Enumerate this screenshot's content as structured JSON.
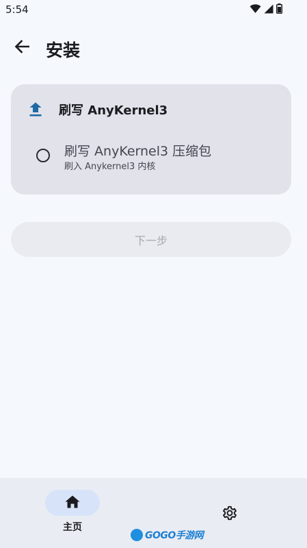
{
  "status_bar": {
    "time": "5:54",
    "icons": [
      "wifi-icon",
      "signal-icon",
      "battery-icon"
    ]
  },
  "top_bar": {
    "back_icon": "arrow-left-icon",
    "title": "安装"
  },
  "card": {
    "icon": "upload-icon",
    "title": "刷写 AnyKernel3",
    "option": {
      "title": "刷写 AnyKernel3 压缩包",
      "subtitle": "刷入 Anykernel3 内核",
      "selected": false
    }
  },
  "next_button": {
    "label": "下一步",
    "enabled": false
  },
  "bottom_nav": {
    "items": [
      {
        "label": "主页",
        "icon": "home-icon",
        "active": true
      },
      {
        "label": "",
        "icon": "gear-icon",
        "active": false
      }
    ]
  },
  "watermark": {
    "text": "GOGO手游网"
  },
  "colors": {
    "background": "#f5f9fe",
    "card": "#e1e2ea",
    "accent": "#1f6aa5",
    "nav_indicator": "#d7e3f8",
    "disabled_button": "#e9ebf0"
  }
}
